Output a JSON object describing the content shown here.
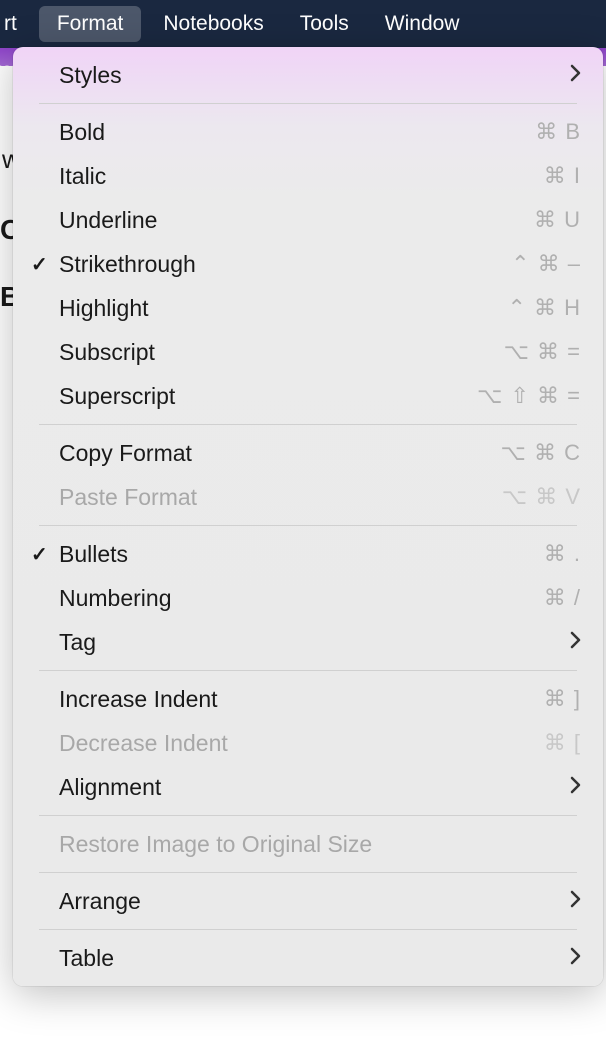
{
  "menubar": {
    "items": [
      {
        "label": "rt"
      },
      {
        "label": "Format"
      },
      {
        "label": "Notebooks"
      },
      {
        "label": "Tools"
      },
      {
        "label": "Window"
      }
    ],
    "active_index": 1
  },
  "background": {
    "letter_w": "w",
    "letter_c": "C",
    "letter_b": "B"
  },
  "menu": {
    "groups": [
      {
        "items": [
          {
            "label": "Styles",
            "submenu": true
          }
        ]
      },
      {
        "items": [
          {
            "label": "Bold",
            "shortcut": "⌘ B"
          },
          {
            "label": "Italic",
            "shortcut": "⌘ I"
          },
          {
            "label": "Underline",
            "shortcut": "⌘ U"
          },
          {
            "label": "Strikethrough",
            "shortcut": "⌃ ⌘ –",
            "checked": true
          },
          {
            "label": "Highlight",
            "shortcut": "⌃ ⌘ H"
          },
          {
            "label": "Subscript",
            "shortcut": "⌥ ⌘ ="
          },
          {
            "label": "Superscript",
            "shortcut": "⌥ ⇧ ⌘ ="
          }
        ]
      },
      {
        "items": [
          {
            "label": "Copy Format",
            "shortcut": "⌥ ⌘ C"
          },
          {
            "label": "Paste Format",
            "shortcut": "⌥ ⌘ V",
            "disabled": true
          }
        ]
      },
      {
        "items": [
          {
            "label": "Bullets",
            "shortcut": "⌘ .",
            "checked": true
          },
          {
            "label": "Numbering",
            "shortcut": "⌘ /"
          },
          {
            "label": "Tag",
            "submenu": true
          }
        ]
      },
      {
        "items": [
          {
            "label": "Increase Indent",
            "shortcut": "⌘ ]"
          },
          {
            "label": "Decrease Indent",
            "shortcut": "⌘ [",
            "disabled": true
          },
          {
            "label": "Alignment",
            "submenu": true
          }
        ]
      },
      {
        "items": [
          {
            "label": "Restore Image to Original Size",
            "disabled": true
          }
        ]
      },
      {
        "items": [
          {
            "label": "Arrange",
            "submenu": true
          }
        ]
      },
      {
        "items": [
          {
            "label": "Table",
            "submenu": true
          }
        ]
      }
    ]
  }
}
